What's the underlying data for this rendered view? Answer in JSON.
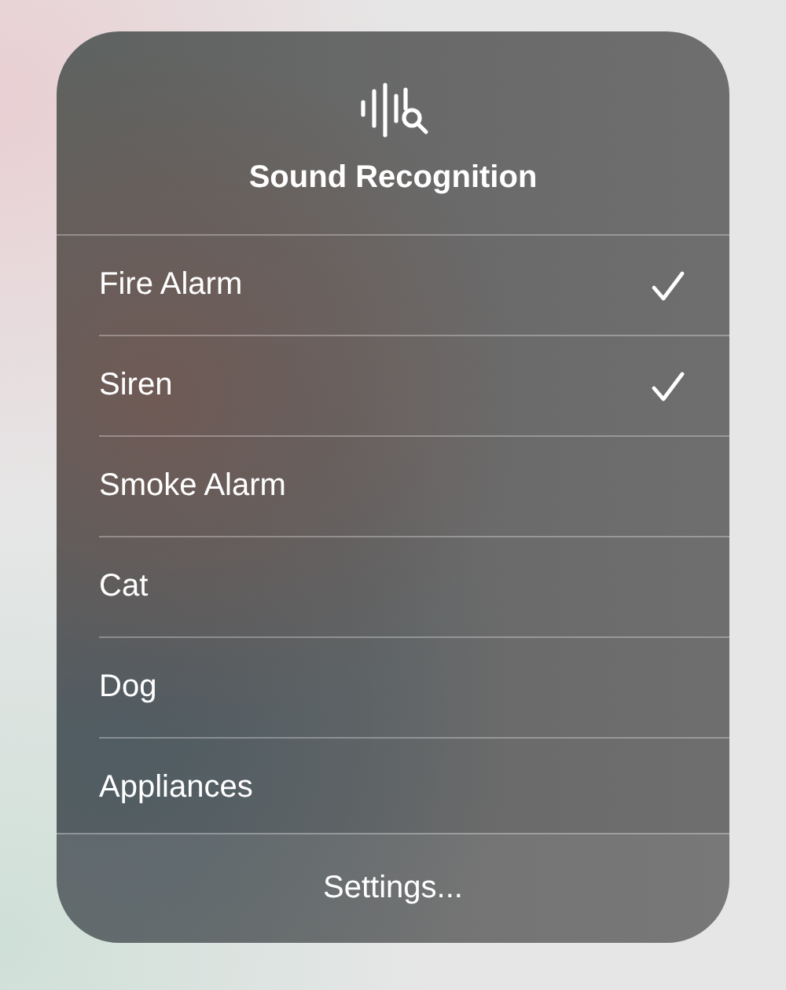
{
  "header": {
    "title": "Sound Recognition"
  },
  "sounds": [
    {
      "label": "Fire Alarm",
      "checked": true
    },
    {
      "label": "Siren",
      "checked": true
    },
    {
      "label": "Smoke Alarm",
      "checked": false
    },
    {
      "label": "Cat",
      "checked": false
    },
    {
      "label": "Dog",
      "checked": false
    },
    {
      "label": "Appliances",
      "checked": false
    }
  ],
  "footer": {
    "button": "Settings..."
  }
}
